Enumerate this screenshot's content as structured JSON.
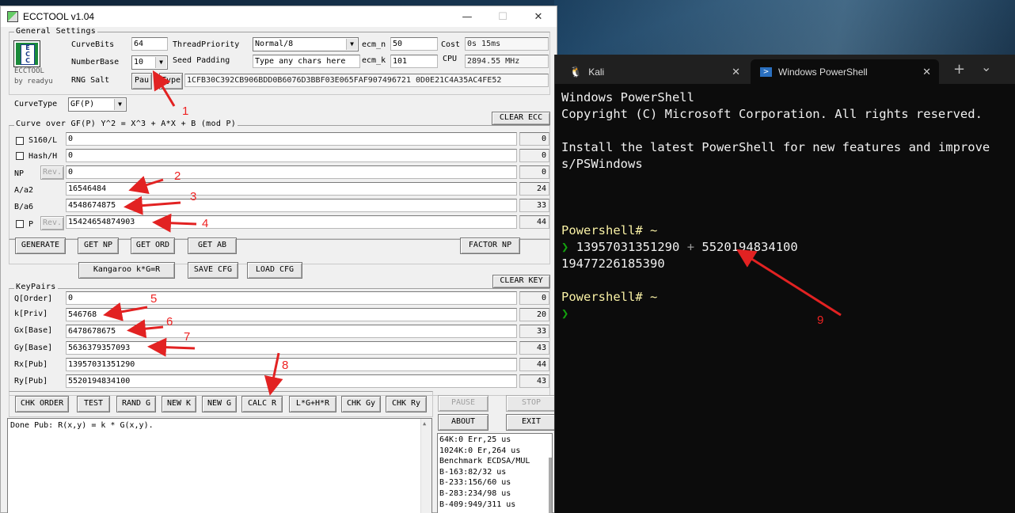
{
  "ecc": {
    "title": "ECCTOOL v1.04",
    "minimize": "—",
    "maximize": "☐",
    "close": "✕",
    "general": {
      "legend": "General Settings",
      "logo_caption": "ECCTOOL",
      "logo_by": "by readyu",
      "curvebits_label": "CurveBits",
      "curvebits_value": "64",
      "numberbase_label": "NumberBase",
      "numberbase_value": "10",
      "rngsalt_label": "RNG Salt",
      "pau_button": "Pau",
      "type_button": "Type",
      "salt_value": "1CFB30C392CB906BDD0B6076D3BBF03E065FAF907496721 0D0E21C4A35AC4FE52",
      "threadpriority_label": "ThreadPriority",
      "threadpriority_value": "Normal/8",
      "seedpadding_label": "Seed Padding",
      "seedpadding_value": "Type any chars here",
      "ecm_n_label": "ecm_n",
      "ecm_n_value": "50",
      "ecm_k_label": "ecm_k",
      "ecm_k_value": "101",
      "cost_label": "Cost",
      "cost_value": "0s 15ms",
      "cpu_label": "CPU",
      "cpu_value": "2894.55 MHz"
    },
    "curvetype_label": "CurveType",
    "curvetype_value": "GF(P)",
    "clear_ecc": "CLEAR ECC",
    "curve": {
      "legend": "Curve over GF(P) Y^2 = X^3 + A*X + B (mod P)",
      "rows": [
        {
          "label": "S160/L",
          "value": "0",
          "count": "0"
        },
        {
          "label": "Hash/H",
          "value": "0",
          "count": "0"
        },
        {
          "label": "NP",
          "value": "0",
          "count": "0"
        },
        {
          "label": "A/a2",
          "value": "16546484",
          "count": "24"
        },
        {
          "label": "B/a6",
          "value": "4548674875",
          "count": "33"
        },
        {
          "label": "P",
          "value": "15424654874903",
          "count": "44"
        }
      ],
      "rev": "Rev."
    },
    "buttons1": [
      "GENERATE",
      "GET NP",
      "GET ORD",
      "GET AB",
      "FACTOR NP"
    ],
    "buttons2": [
      "Kangaroo k*G=R",
      "SAVE CFG",
      "LOAD CFG"
    ],
    "clear_key": "CLEAR KEY",
    "keypairs": {
      "legend": "KeyPairs",
      "rows": [
        {
          "label": "Q[Order]",
          "value": "0",
          "count": "0"
        },
        {
          "label": "k[Priv]",
          "value": "546768",
          "count": "20"
        },
        {
          "label": "Gx[Base]",
          "value": "6478678675",
          "count": "33"
        },
        {
          "label": "Gy[Base]",
          "value": "5636379357093",
          "count": "43"
        },
        {
          "label": "Rx[Pub]",
          "value": "13957031351290",
          "count": "44"
        },
        {
          "label": "Ry[Pub]",
          "value": "5520194834100",
          "count": "43"
        }
      ]
    },
    "buttons3": [
      "CHK ORDER",
      "TEST",
      "RAND G",
      "NEW K",
      "NEW G",
      "CALC R",
      "L*G+H*R",
      "CHK Gy",
      "CHK Ry"
    ],
    "pause": "PAUSE",
    "stop": "STOP",
    "about": "ABOUT",
    "exit": "EXIT",
    "log_text": "Done Pub: R(x,y) = k * G(x,y).",
    "bench": [
      "64K:0 Err,25 us",
      "1024K:0 Er,264 us",
      "Benchmark ECDSA/MUL",
      "B-163:82/32 us",
      "B-233:156/60 us",
      "B-283:234/98 us",
      "B-409:949/311 us"
    ]
  },
  "annotations": [
    "1",
    "2",
    "3",
    "4",
    "5",
    "6",
    "7",
    "8",
    "9"
  ],
  "terminal": {
    "tabs": [
      {
        "label": "Kali",
        "icon": "linux-icon"
      },
      {
        "label": "Windows PowerShell",
        "icon": "powershell-icon"
      }
    ],
    "new_tab": "+",
    "dropdown": "⌄",
    "lines": {
      "l1": "Windows PowerShell",
      "l2": "Copyright (C) Microsoft Corporation. All rights reserved.",
      "l3": "Install the latest PowerShell for new features and improve",
      "l4": "s/PSWindows",
      "prompt": "Powershell# ~",
      "chevron": "❯",
      "cmd_a": "13957031351290",
      "cmd_op": "+",
      "cmd_b": "5520194834100",
      "result": "19477226185390"
    }
  },
  "colors": {
    "accent_red": "#e22222",
    "prompt_yellow": "#f9f1a5",
    "chevron_green": "#13a10e"
  }
}
